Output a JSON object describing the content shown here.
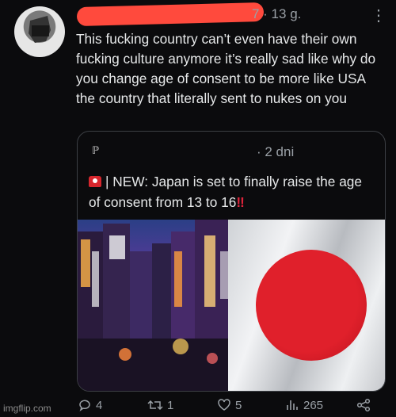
{
  "tweet": {
    "timestamp": "7 · 13 g.",
    "more_icon": "more-vertical-icon",
    "text": "This fucking country can’t even have their own fucking culture anymore it’s really sad like why do you change age of consent to be more like USA the country that literally sent to nukes on you"
  },
  "quote": {
    "account_glyph": "ℙ",
    "timestamp": "· 2 dni",
    "siren_icon": "siren-icon",
    "text_main": "| NEW: Japan is set to finally raise the age of consent from 13 to 16",
    "exclaim": "‼",
    "images": [
      "city-night-image",
      "japan-flag-image"
    ]
  },
  "actions": {
    "replies": "4",
    "retweets": "1",
    "likes": "5",
    "views": "265"
  },
  "watermark": "imgflip.com",
  "colors": {
    "background": "#0b0b0d",
    "redaction": "#ff4a3d",
    "flag_red": "#e0202b"
  }
}
